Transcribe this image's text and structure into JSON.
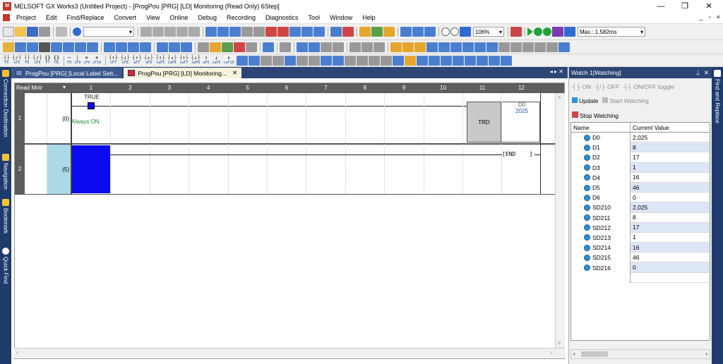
{
  "window": {
    "title": "MELSOFT GX Works3 (Untitled Project) - [ProgPou [PRG] [LD] Monitoring (Read Only) 6Step]",
    "minimize": "—",
    "restore": "❐",
    "close": "✕"
  },
  "menu": [
    "Project",
    "Edit",
    "Find/Replace",
    "Convert",
    "View",
    "Online",
    "Debug",
    "Recording",
    "Diagnostics",
    "Tool",
    "Window",
    "Help"
  ],
  "mdi_controls": [
    "_",
    "▫",
    "×"
  ],
  "toolbar": {
    "zoom": "106%",
    "scan_time": "Max.: 1.582ms",
    "ladder_keys": [
      {
        "sym": "┤├",
        "key": "F5"
      },
      {
        "sym": "┤/├",
        "key": "sF5"
      },
      {
        "sym": "┤├",
        "key": "F6"
      },
      {
        "sym": "┤/├",
        "key": "sF6"
      },
      {
        "sym": "{}",
        "key": "F7"
      },
      {
        "sym": "{}",
        "key": "F8"
      },
      {
        "sym": "─",
        "key": "F9"
      },
      {
        "sym": "│",
        "key": "sF9"
      },
      {
        "sym": "×",
        "key": "cF9"
      },
      {
        "sym": "×",
        "key": "cF10"
      },
      {
        "sym": "┤↑├",
        "key": "sF7"
      },
      {
        "sym": "┤↓├",
        "key": "sF8"
      },
      {
        "sym": "┤↑├",
        "key": "aF7"
      },
      {
        "sym": "┤↓├",
        "key": "aF8"
      },
      {
        "sym": "┤↑├",
        "key": "saF5"
      },
      {
        "sym": "┤↓├",
        "key": "saF6"
      },
      {
        "sym": "┤↑├",
        "key": "saF7"
      },
      {
        "sym": "┤↓├",
        "key": "saF8"
      },
      {
        "sym": "↑",
        "key": "aF5"
      },
      {
        "sym": "↓",
        "key": "caF5"
      },
      {
        "sym": "↕",
        "key": "caF10"
      }
    ]
  },
  "sidebar_left": [
    "Connection Destination",
    "Navigation",
    "Bookmark",
    "Quick Find"
  ],
  "sidebar_right": [
    "Find and Replace"
  ],
  "tabs": [
    {
      "label": "ProgPou [PRG] [Local Label Sett...",
      "active": false
    },
    {
      "label": "ProgPou [PRG] [LD] Monitoring...",
      "active": true
    }
  ],
  "ladder": {
    "mode": "Read Mntr",
    "columns": [
      "1",
      "2",
      "3",
      "4",
      "5",
      "6",
      "7",
      "8",
      "9",
      "10",
      "11",
      "12"
    ],
    "rungs": [
      {
        "row": "1",
        "step": "(0)",
        "contact_state": "TRUE",
        "contact_label": "Always ON",
        "instruction": "TRD",
        "device": "D0",
        "device_value": "2025"
      },
      {
        "row": "2",
        "step": "(5)",
        "end": "END"
      }
    ]
  },
  "watch": {
    "title": "Watch 1[Watching]",
    "pin": "⊥",
    "close": "✕",
    "on": "ON",
    "off": "OFF",
    "toggle": "ON/OFF toggle",
    "update": "Update",
    "start": "Start Watching",
    "stop": "Stop Watching",
    "col_name": "Name",
    "col_value": "Current Value",
    "rows": [
      {
        "name": "D0",
        "value": "2,025"
      },
      {
        "name": "D1",
        "value": "8"
      },
      {
        "name": "D2",
        "value": "17"
      },
      {
        "name": "D3",
        "value": "1"
      },
      {
        "name": "D4",
        "value": "16"
      },
      {
        "name": "D5",
        "value": "46"
      },
      {
        "name": "D6",
        "value": "0"
      },
      {
        "name": "SD210",
        "value": "2,025"
      },
      {
        "name": "SD211",
        "value": "8"
      },
      {
        "name": "SD212",
        "value": "17"
      },
      {
        "name": "SD213",
        "value": "1"
      },
      {
        "name": "SD214",
        "value": "16"
      },
      {
        "name": "SD215",
        "value": "46"
      },
      {
        "name": "SD216",
        "value": "0"
      }
    ]
  },
  "colors": {
    "accent": "#2b4574",
    "selection": "#0000e6",
    "true_green": "#1a8c2e"
  }
}
